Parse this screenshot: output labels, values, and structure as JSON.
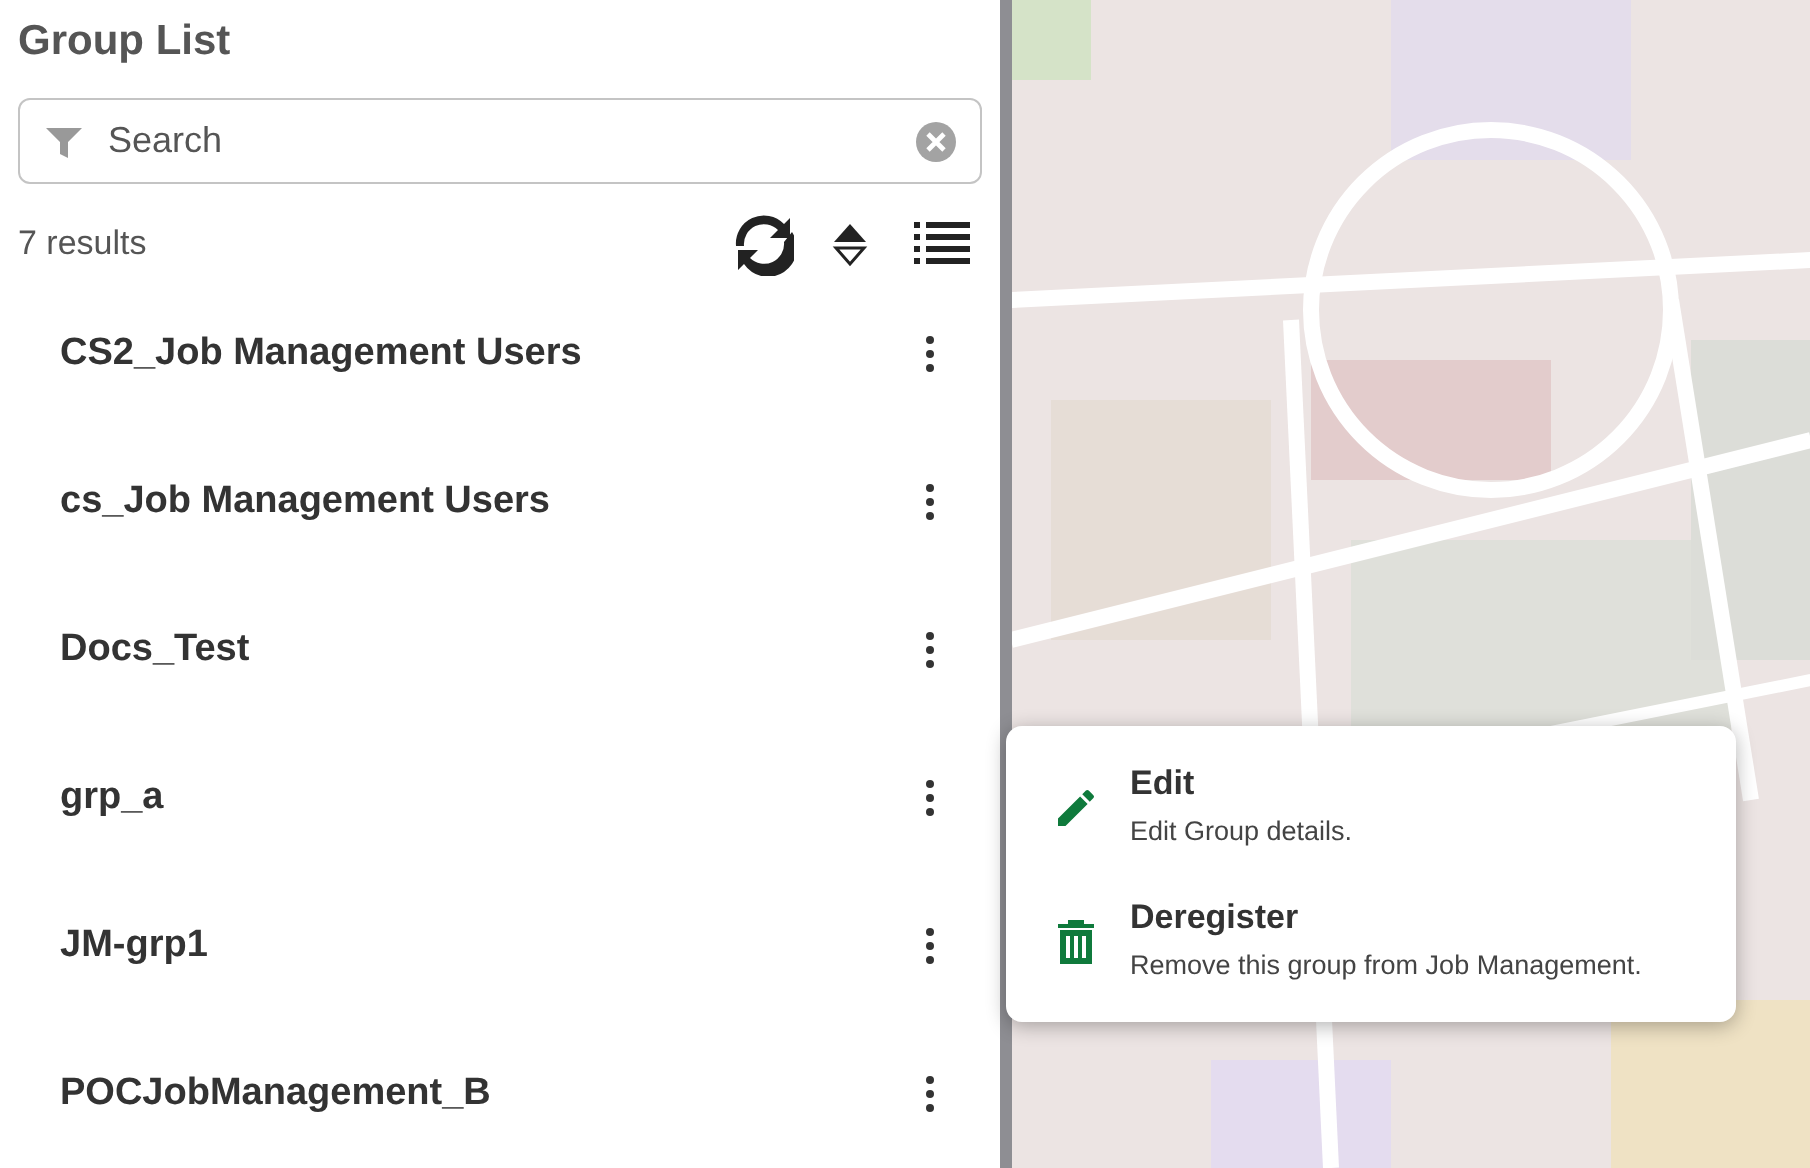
{
  "panel": {
    "title": "Group List",
    "search": {
      "placeholder": "Search"
    },
    "result_count": "7 results"
  },
  "groups": [
    {
      "name": "CS2_Job Management Users"
    },
    {
      "name": "cs_Job Management Users"
    },
    {
      "name": "Docs_Test"
    },
    {
      "name": "grp_a"
    },
    {
      "name": "JM-grp1"
    },
    {
      "name": "POCJobManagement_B"
    }
  ],
  "context_menu": [
    {
      "kind": "edit",
      "label": "Edit",
      "description": "Edit Group details."
    },
    {
      "kind": "delete",
      "label": "Deregister",
      "description": "Remove this group from Job Management."
    }
  ]
}
